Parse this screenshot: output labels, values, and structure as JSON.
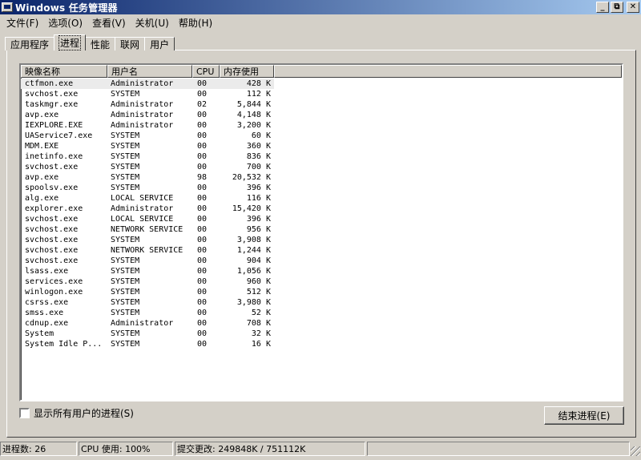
{
  "window": {
    "title": "Windows 任务管理器",
    "buttons": {
      "minimize": "_",
      "maximize": "⧉",
      "close": "✕"
    }
  },
  "menu": [
    "文件(F)",
    "选项(O)",
    "查看(V)",
    "关机(U)",
    "帮助(H)"
  ],
  "tabs": [
    {
      "label": "应用程序",
      "active": false
    },
    {
      "label": "进程",
      "active": true
    },
    {
      "label": "性能",
      "active": false
    },
    {
      "label": "联网",
      "active": false
    },
    {
      "label": "用户",
      "active": false
    }
  ],
  "columns": [
    "映像名称",
    "用户名",
    "CPU",
    "内存使用"
  ],
  "processes": [
    [
      "ctfmon.exe",
      "Administrator",
      "00",
      "428 K"
    ],
    [
      "svchost.exe",
      "SYSTEM",
      "00",
      "112 K"
    ],
    [
      "taskmgr.exe",
      "Administrator",
      "02",
      "5,844 K"
    ],
    [
      "avp.exe",
      "Administrator",
      "00",
      "4,148 K"
    ],
    [
      "IEXPLORE.EXE",
      "Administrator",
      "00",
      "3,200 K"
    ],
    [
      "UAService7.exe",
      "SYSTEM",
      "00",
      "60 K"
    ],
    [
      "MDM.EXE",
      "SYSTEM",
      "00",
      "360 K"
    ],
    [
      "inetinfo.exe",
      "SYSTEM",
      "00",
      "836 K"
    ],
    [
      "svchost.exe",
      "SYSTEM",
      "00",
      "700 K"
    ],
    [
      "avp.exe",
      "SYSTEM",
      "98",
      "20,532 K"
    ],
    [
      "spoolsv.exe",
      "SYSTEM",
      "00",
      "396 K"
    ],
    [
      "alg.exe",
      "LOCAL SERVICE",
      "00",
      "116 K"
    ],
    [
      "explorer.exe",
      "Administrator",
      "00",
      "15,420 K"
    ],
    [
      "svchost.exe",
      "LOCAL SERVICE",
      "00",
      "396 K"
    ],
    [
      "svchost.exe",
      "NETWORK SERVICE",
      "00",
      "956 K"
    ],
    [
      "svchost.exe",
      "SYSTEM",
      "00",
      "3,908 K"
    ],
    [
      "svchost.exe",
      "NETWORK SERVICE",
      "00",
      "1,244 K"
    ],
    [
      "svchost.exe",
      "SYSTEM",
      "00",
      "904 K"
    ],
    [
      "lsass.exe",
      "SYSTEM",
      "00",
      "1,056 K"
    ],
    [
      "services.exe",
      "SYSTEM",
      "00",
      "960 K"
    ],
    [
      "winlogon.exe",
      "SYSTEM",
      "00",
      "512 K"
    ],
    [
      "csrss.exe",
      "SYSTEM",
      "00",
      "3,980 K"
    ],
    [
      "smss.exe",
      "SYSTEM",
      "00",
      "52 K"
    ],
    [
      "cdnup.exe",
      "Administrator",
      "00",
      "708 K"
    ],
    [
      "System",
      "SYSTEM",
      "00",
      "32 K"
    ],
    [
      "System Idle P...",
      "SYSTEM",
      "00",
      "16 K"
    ]
  ],
  "selected_row": 0,
  "show_all_users": {
    "label": "显示所有用户的进程(S)",
    "checked": false
  },
  "end_process_button": "结束进程(E)",
  "status": {
    "processes": "进程数: 26",
    "cpu": "CPU 使用: 100%",
    "commit": "提交更改: 249848K / 751112K"
  }
}
